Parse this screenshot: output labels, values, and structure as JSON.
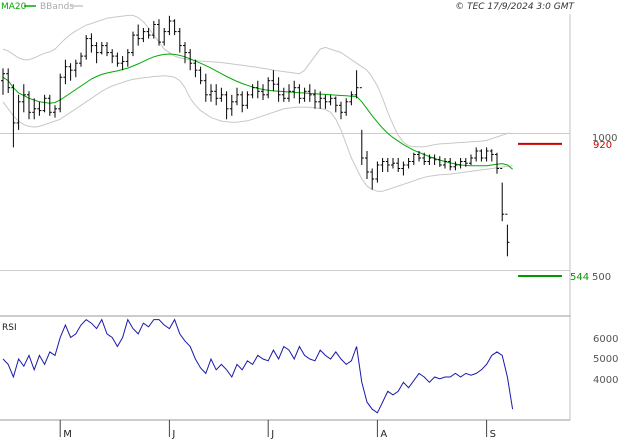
{
  "header": {
    "legend_ma": "MA20",
    "legend_bb": "BBands",
    "copyright": "© TEC 17/9/2024 3:0 GMT"
  },
  "colors": {
    "ma": "#00aa00",
    "bbands": "#c8c8c8",
    "price": "#000000",
    "rsi": "#1a1aaa",
    "resistance": "#cc0000",
    "support": "#009900",
    "grid": "#cccccc"
  },
  "chart_data": [
    {
      "type": "ohlc",
      "name": "price",
      "ylim": [
        430,
        1290
      ],
      "y_ticks": [
        1000,
        500
      ],
      "x_labels": [
        "M",
        "J",
        "J",
        "A",
        "S"
      ],
      "x_label_index": [
        11,
        32,
        51,
        72,
        93
      ],
      "resistance": {
        "value": 920,
        "label": "920"
      },
      "support": {
        "value": 544,
        "label": "544"
      },
      "ohlc": [
        [
          1100,
          1135,
          1060,
          1120
        ],
        [
          1120,
          1135,
          1065,
          1080
        ],
        [
          1080,
          1090,
          910,
          980
        ],
        [
          980,
          1060,
          960,
          1040
        ],
        [
          1040,
          1090,
          1010,
          1060
        ],
        [
          1060,
          1070,
          990,
          1010
        ],
        [
          1010,
          1050,
          990,
          1020
        ],
        [
          1020,
          1040,
          1000,
          1015
        ],
        [
          1015,
          1060,
          1010,
          1050
        ],
        [
          1050,
          1060,
          1000,
          1010
        ],
        [
          1010,
          1030,
          995,
          1020
        ],
        [
          1020,
          1120,
          1010,
          1110
        ],
        [
          1110,
          1160,
          1090,
          1140
        ],
        [
          1140,
          1150,
          1100,
          1130
        ],
        [
          1130,
          1160,
          1110,
          1150
        ],
        [
          1150,
          1180,
          1140,
          1170
        ],
        [
          1170,
          1230,
          1160,
          1220
        ],
        [
          1220,
          1235,
          1180,
          1200
        ],
        [
          1200,
          1210,
          1150,
          1180
        ],
        [
          1180,
          1210,
          1175,
          1200
        ],
        [
          1200,
          1210,
          1170,
          1180
        ],
        [
          1180,
          1190,
          1150,
          1170
        ],
        [
          1170,
          1180,
          1140,
          1150
        ],
        [
          1150,
          1170,
          1130,
          1155
        ],
        [
          1155,
          1190,
          1140,
          1180
        ],
        [
          1180,
          1240,
          1170,
          1230
        ],
        [
          1230,
          1260,
          1200,
          1220
        ],
        [
          1220,
          1250,
          1210,
          1240
        ],
        [
          1240,
          1250,
          1220,
          1230
        ],
        [
          1230,
          1270,
          1220,
          1260
        ],
        [
          1260,
          1275,
          1200,
          1210
        ],
        [
          1210,
          1250,
          1200,
          1240
        ],
        [
          1240,
          1285,
          1230,
          1270
        ],
        [
          1270,
          1275,
          1230,
          1240
        ],
        [
          1240,
          1250,
          1180,
          1200
        ],
        [
          1200,
          1210,
          1150,
          1180
        ],
        [
          1180,
          1190,
          1130,
          1150
        ],
        [
          1150,
          1160,
          1110,
          1130
        ],
        [
          1130,
          1140,
          1090,
          1100
        ],
        [
          1100,
          1120,
          1040,
          1060
        ],
        [
          1060,
          1090,
          1040,
          1070
        ],
        [
          1070,
          1090,
          1030,
          1050
        ],
        [
          1050,
          1080,
          1040,
          1060
        ],
        [
          1060,
          1070,
          990,
          1020
        ],
        [
          1020,
          1060,
          1000,
          1040
        ],
        [
          1040,
          1080,
          1030,
          1060
        ],
        [
          1060,
          1070,
          1010,
          1030
        ],
        [
          1030,
          1070,
          1020,
          1060
        ],
        [
          1060,
          1090,
          1050,
          1080
        ],
        [
          1080,
          1100,
          1050,
          1070
        ],
        [
          1070,
          1090,
          1045,
          1060
        ],
        [
          1060,
          1110,
          1050,
          1100
        ],
        [
          1100,
          1130,
          1070,
          1090
        ],
        [
          1090,
          1110,
          1040,
          1060
        ],
        [
          1060,
          1080,
          1040,
          1050
        ],
        [
          1050,
          1090,
          1040,
          1070
        ],
        [
          1070,
          1100,
          1050,
          1080
        ],
        [
          1080,
          1090,
          1035,
          1050
        ],
        [
          1050,
          1080,
          1040,
          1070
        ],
        [
          1070,
          1090,
          1040,
          1060
        ],
        [
          1060,
          1075,
          1020,
          1040
        ],
        [
          1040,
          1070,
          1020,
          1050
        ],
        [
          1050,
          1060,
          1020,
          1040
        ],
        [
          1040,
          1060,
          1030,
          1050
        ],
        [
          1050,
          1055,
          1010,
          1030
        ],
        [
          1030,
          1040,
          990,
          1010
        ],
        [
          1010,
          1050,
          1000,
          1040
        ],
        [
          1040,
          1070,
          1030,
          1060
        ],
        [
          1060,
          1130,
          1050,
          1080
        ],
        [
          1080,
          960,
          860,
          880
        ],
        [
          880,
          900,
          820,
          840
        ],
        [
          840,
          850,
          790,
          820
        ],
        [
          820,
          870,
          810,
          860
        ],
        [
          860,
          880,
          840,
          870
        ],
        [
          870,
          880,
          840,
          860
        ],
        [
          860,
          880,
          850,
          865
        ],
        [
          865,
          880,
          840,
          850
        ],
        [
          850,
          870,
          830,
          860
        ],
        [
          860,
          880,
          850,
          870
        ],
        [
          870,
          895,
          860,
          890
        ],
        [
          890,
          900,
          870,
          880
        ],
        [
          880,
          895,
          860,
          870
        ],
        [
          870,
          890,
          860,
          880
        ],
        [
          880,
          890,
          860,
          875
        ],
        [
          875,
          885,
          855,
          860
        ],
        [
          860,
          880,
          850,
          870
        ],
        [
          870,
          880,
          845,
          855
        ],
        [
          855,
          870,
          845,
          860
        ],
        [
          860,
          880,
          850,
          870
        ],
        [
          870,
          880,
          855,
          865
        ],
        [
          865,
          890,
          860,
          880
        ],
        [
          880,
          910,
          870,
          900
        ],
        [
          900,
          905,
          870,
          880
        ],
        [
          880,
          910,
          870,
          900
        ],
        [
          900,
          905,
          870,
          890
        ],
        [
          890,
          895,
          835,
          850
        ],
        [
          850,
          810,
          700,
          720
        ],
        [
          720,
          690,
          600,
          640
        ]
      ],
      "ma20": [
        1110,
        1100,
        1080,
        1065,
        1058,
        1050,
        1045,
        1040,
        1038,
        1036,
        1038,
        1045,
        1055,
        1065,
        1075,
        1085,
        1095,
        1105,
        1112,
        1118,
        1122,
        1125,
        1128,
        1132,
        1136,
        1142,
        1148,
        1155,
        1162,
        1168,
        1172,
        1175,
        1176,
        1175,
        1172,
        1168,
        1162,
        1156,
        1150,
        1143,
        1136,
        1128,
        1120,
        1112,
        1105,
        1098,
        1092,
        1087,
        1082,
        1078,
        1075,
        1073,
        1071,
        1070,
        1069,
        1068,
        1067,
        1066,
        1065,
        1064,
        1063,
        1062,
        1061,
        1060,
        1059,
        1058,
        1057,
        1056,
        1055,
        1040,
        1020,
        1000,
        982,
        965,
        950,
        938,
        928,
        918,
        910,
        902,
        896,
        890,
        884,
        879,
        874,
        870,
        866,
        863,
        860,
        859,
        858,
        858,
        858,
        858,
        860,
        862,
        864,
        860,
        848
      ],
      "bb_upper": [
        1190,
        1185,
        1175,
        1165,
        1160,
        1160,
        1165,
        1172,
        1178,
        1182,
        1190,
        1205,
        1220,
        1232,
        1242,
        1250,
        1258,
        1263,
        1268,
        1273,
        1278,
        1280,
        1282,
        1284,
        1286,
        1286,
        1280,
        1268,
        1250,
        1230,
        1210,
        1190,
        1180,
        1170,
        1165,
        1162,
        1160,
        1158,
        1156,
        1155,
        1154,
        1153,
        1152,
        1150,
        1148,
        1146,
        1144,
        1142,
        1140,
        1138,
        1135,
        1133,
        1130,
        1128,
        1126,
        1124,
        1122,
        1120,
        1130,
        1150,
        1170,
        1190,
        1195,
        1190,
        1185,
        1180,
        1170,
        1160,
        1150,
        1140,
        1130,
        1110,
        1085,
        1050,
        1010,
        975,
        945,
        925,
        915,
        912,
        912,
        912,
        915,
        918,
        920,
        921,
        922,
        923,
        924,
        925,
        926,
        927,
        928,
        930,
        935,
        940,
        945,
        950,
        950
      ],
      "bb_lower": [
        1040,
        1020,
        1000,
        985,
        975,
        970,
        968,
        970,
        975,
        980,
        985,
        990,
        1000,
        1010,
        1020,
        1030,
        1040,
        1050,
        1060,
        1070,
        1078,
        1085,
        1090,
        1095,
        1100,
        1104,
        1106,
        1108,
        1110,
        1112,
        1113,
        1114,
        1113,
        1110,
        1100,
        1080,
        1050,
        1030,
        1015,
        1005,
        995,
        990,
        985,
        983,
        982,
        982,
        984,
        986,
        990,
        995,
        1000,
        1005,
        1010,
        1015,
        1020,
        1022,
        1024,
        1025,
        1025,
        1024,
        1023,
        1021,
        1018,
        1010,
        990,
        960,
        920,
        880,
        850,
        820,
        800,
        790,
        785,
        785,
        790,
        795,
        800,
        805,
        810,
        815,
        820,
        825,
        828,
        830,
        832,
        833,
        834,
        836,
        838,
        840,
        842,
        844,
        846,
        848,
        850,
        852,
        854,
        856,
        858
      ]
    },
    {
      "type": "line",
      "name": "RSI",
      "ylim": [
        14,
        72
      ],
      "y_ticks": [
        60,
        50,
        40
      ],
      "y_tick_labels": [
        "6000",
        "5000",
        "4000"
      ],
      "values": [
        48,
        45,
        38,
        48,
        44,
        50,
        42,
        50,
        45,
        52,
        50,
        60,
        67,
        60,
        62,
        67,
        70,
        68,
        65,
        70,
        62,
        60,
        55,
        60,
        70,
        65,
        62,
        68,
        66,
        70,
        70,
        67,
        65,
        70,
        62,
        58,
        55,
        48,
        43,
        40,
        48,
        42,
        45,
        42,
        38,
        45,
        42,
        47,
        45,
        50,
        48,
        47,
        53,
        48,
        55,
        53,
        48,
        55,
        50,
        48,
        47,
        53,
        50,
        48,
        52,
        48,
        45,
        47,
        55,
        35,
        24,
        20,
        18,
        24,
        30,
        28,
        30,
        35,
        32,
        36,
        40,
        38,
        35,
        38,
        37,
        38,
        38,
        40,
        38,
        40,
        39,
        40,
        42,
        45,
        50,
        52,
        50,
        38,
        20
      ]
    }
  ]
}
